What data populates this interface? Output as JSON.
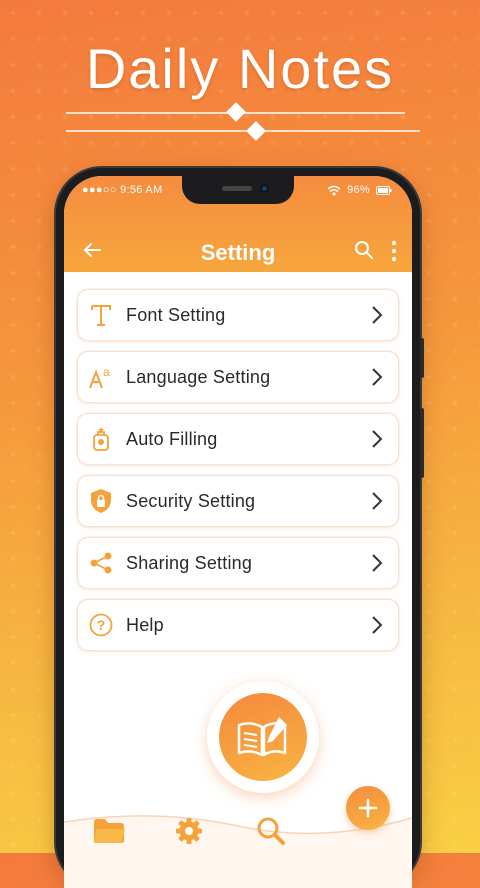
{
  "promo": {
    "headline": "Daily Notes"
  },
  "status_bar": {
    "time": "9:56 AM",
    "battery": "96%",
    "signal_icon": "signal-dots-icon",
    "wifi_icon": "wifi-icon",
    "battery_icon": "battery-icon"
  },
  "app_bar": {
    "title": "Setting",
    "back_icon": "arrow-left-icon",
    "search_icon": "search-icon",
    "more_icon": "more-vert-icon"
  },
  "settings": {
    "items": [
      {
        "label": "Font Setting",
        "icon": "font-icon"
      },
      {
        "label": "Language Setting",
        "icon": "language-icon"
      },
      {
        "label": "Auto Filling",
        "icon": "auto-fill-icon"
      },
      {
        "label": "Security Setting",
        "icon": "lock-shield-icon"
      },
      {
        "label": "Sharing Setting",
        "icon": "share-icon"
      },
      {
        "label": "Help",
        "icon": "help-circle-icon"
      }
    ]
  },
  "bottom_nav": {
    "items": [
      {
        "icon": "folder-icon"
      },
      {
        "icon": "gear-icon"
      },
      {
        "icon": "search-icon"
      }
    ]
  },
  "fab": {
    "main_icon": "notebook-pen-icon",
    "add_icon": "plus-icon"
  },
  "colors": {
    "accent": "#F58C3F",
    "accent_light": "#F8B442",
    "icon_orange": "#F5A23A"
  }
}
